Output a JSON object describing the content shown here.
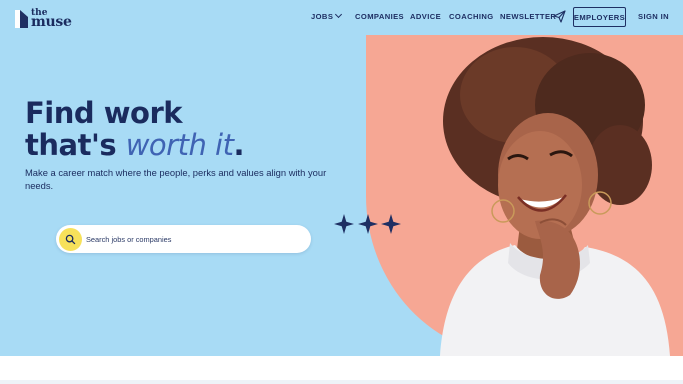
{
  "brand": {
    "line1": "the",
    "line2": "muse"
  },
  "nav": {
    "jobs": "JOBS",
    "companies": "COMPANIES",
    "advice": "ADVICE",
    "coaching": "COACHING",
    "newsletter": "NEWSLETTER",
    "employers": "EMPLOYERS",
    "sign_in": "SIGN IN"
  },
  "hero": {
    "headline_line1": "Find work",
    "headline_line2_start": "that's ",
    "headline_accent": "worth it",
    "headline_end": ".",
    "subtext": "Make a career match where the people, perks and values align with your needs."
  },
  "search": {
    "placeholder": "Search jobs or companies",
    "value": ""
  },
  "icons": {
    "logo": "the-muse-logo-mark",
    "search": "search-icon",
    "newsletter": "paper-plane-icon",
    "decor": "sparkle-stars"
  },
  "colors": {
    "hero_bg": "#a8dbf5",
    "peach": "#f6a794",
    "navy": "#1a2b5e",
    "accent_blue": "#3f63b3",
    "search_button": "#f7e15b"
  }
}
